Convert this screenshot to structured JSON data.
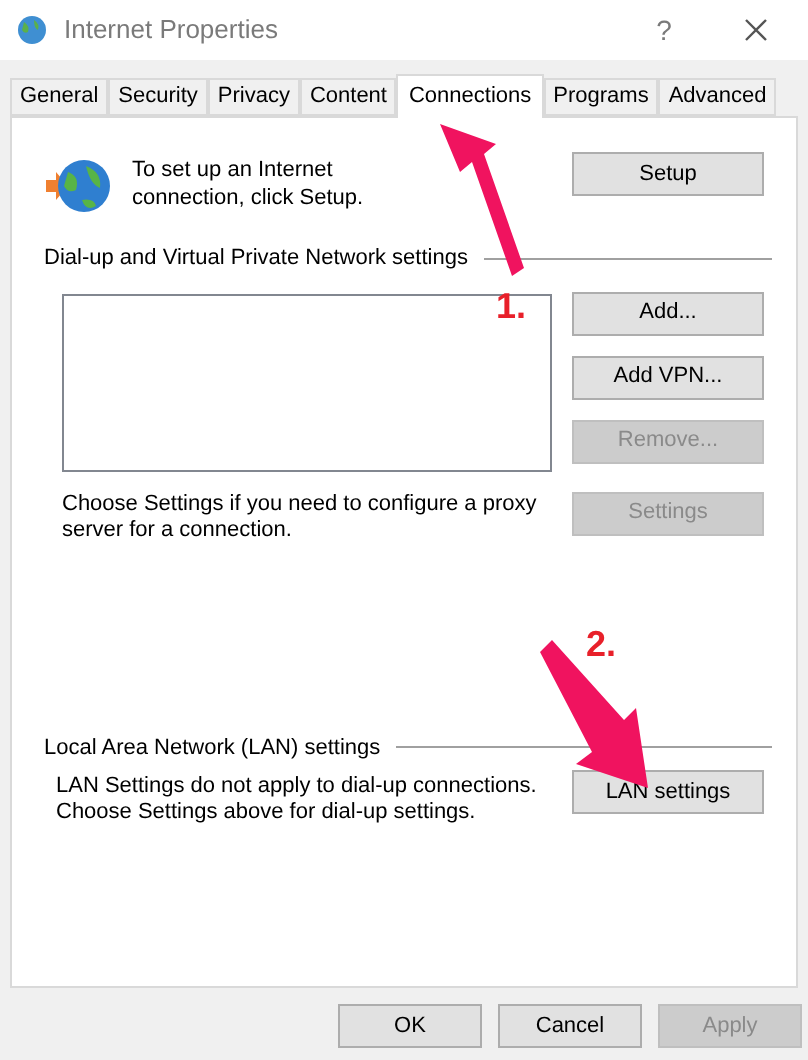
{
  "window": {
    "title": "Internet Properties",
    "help": "?"
  },
  "tabs": [
    {
      "label": "General",
      "selected": false
    },
    {
      "label": "Security",
      "selected": false
    },
    {
      "label": "Privacy",
      "selected": false
    },
    {
      "label": "Content",
      "selected": false
    },
    {
      "label": "Connections",
      "selected": true
    },
    {
      "label": "Programs",
      "selected": false
    },
    {
      "label": "Advanced",
      "selected": false
    }
  ],
  "setup": {
    "text": "To set up an Internet connection, click Setup.",
    "button": "Setup"
  },
  "vpn_section": {
    "title": "Dial-up and Virtual Private Network settings",
    "buttons": [
      {
        "label": "Add...",
        "disabled": false
      },
      {
        "label": "Add VPN...",
        "disabled": false
      },
      {
        "label": "Remove...",
        "disabled": true
      }
    ],
    "proxy_text": "Choose Settings if you need to configure a proxy server for a connection.",
    "settings_button": {
      "label": "Settings",
      "disabled": true
    }
  },
  "lan_section": {
    "title": "Local Area Network (LAN) settings",
    "text": "LAN Settings do not apply to dial-up connections. Choose Settings above for dial-up settings.",
    "button": "LAN settings"
  },
  "footer_buttons": [
    {
      "label": "OK",
      "disabled": false
    },
    {
      "label": "Cancel",
      "disabled": false
    },
    {
      "label": "Apply",
      "disabled": true
    }
  ],
  "annotations": [
    {
      "label": "1."
    },
    {
      "label": "2."
    }
  ]
}
